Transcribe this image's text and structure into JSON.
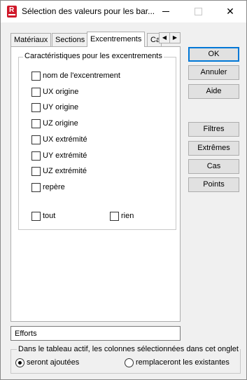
{
  "window": {
    "title": "Sélection des valeurs pour les bar...",
    "minimize": "—",
    "maximize": "☐",
    "close": "✕"
  },
  "tabs": [
    {
      "label": "Matériaux"
    },
    {
      "label": "Sections"
    },
    {
      "label": "Excentrements"
    },
    {
      "label": "Ca"
    }
  ],
  "tab_scroll": {
    "left": "◀",
    "right": "▶"
  },
  "group": {
    "title": "Caractéristiques pour les excentrements",
    "items": [
      {
        "label": "nom de l'excentrement",
        "checked": false
      },
      {
        "label": "UX origine",
        "checked": false
      },
      {
        "label": "UY origine",
        "checked": false
      },
      {
        "label": "UZ origine",
        "checked": false
      },
      {
        "label": "UX extrémité",
        "checked": false
      },
      {
        "label": "UY extrémité",
        "checked": false
      },
      {
        "label": "UZ extrémité",
        "checked": false
      },
      {
        "label": "repère",
        "checked": false
      }
    ],
    "all_label": "tout",
    "none_label": "rien"
  },
  "buttons": {
    "ok": "OK",
    "cancel": "Annuler",
    "help": "Aide",
    "filters": "Filtres",
    "extremes": "Extrêmes",
    "cases": "Cas",
    "points": "Points"
  },
  "efforts_field": "Efforts",
  "bottom": {
    "title": "Dans le tableau actif, les colonnes sélectionnées dans cet onglet",
    "option_add": "seront ajoutées",
    "option_replace": "remplaceront les existantes",
    "selected": "add"
  },
  "colors": {
    "accent": "#0078d7",
    "app_icon": "#d0182a"
  }
}
